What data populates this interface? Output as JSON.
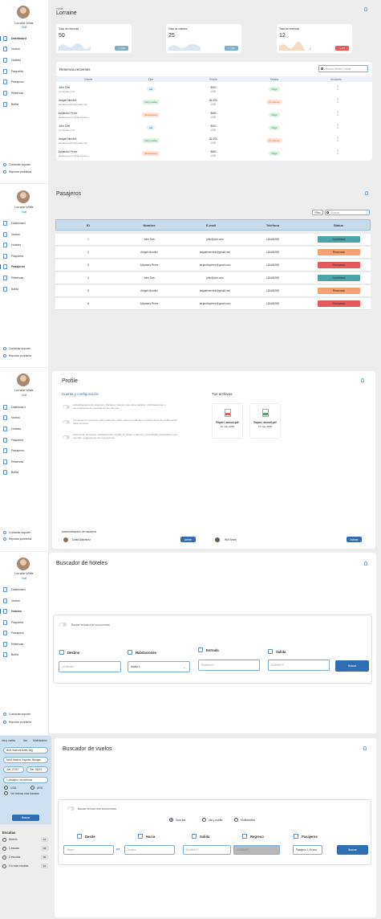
{
  "user": {
    "name": "Lorraine White",
    "role": "Staff"
  },
  "nav": [
    "Dashboard",
    "Vuelos",
    "Hoteles",
    "Paquetes",
    "Pasajeros",
    "Reservas",
    "Bolita"
  ],
  "footer": {
    "support": "Contactar soporte",
    "report": "Reportar problema"
  },
  "dashboard": {
    "greeting": "Hola,",
    "name": "Lorraine",
    "stats": [
      {
        "title": "Total de reservas",
        "value": "50",
        "badge": "14%",
        "color": "#7fb0c9"
      },
      {
        "title": "Total de clientes",
        "value": "25",
        "badge": "19%",
        "color": "#7fb0c9"
      },
      {
        "title": "Total de reservas",
        "value": "12",
        "badge": "2%",
        "color": "#e85a5a"
      }
    ],
    "recent_title": "Reservas recientes",
    "search_placeholder": "Buscar cliente o email",
    "columns": [
      "Cliente",
      "Tipo",
      "Precio",
      "Estado",
      "Acciones"
    ],
    "rows": [
      {
        "name": "John Doe",
        "email": "john@doe.com",
        "type": "Ida",
        "price": "$990",
        "cur": "USD",
        "status": "Pago"
      },
      {
        "name": "Abigail Mendez",
        "email": "abigailmendez@gmail.com",
        "type": "Ida y vuelta",
        "price": "$1.000",
        "cur": "USD",
        "status": "Pendiente"
      },
      {
        "name": "Alejandro Perez",
        "email": "alejandroperez@gmail.com",
        "type": "Multidestino",
        "price": "$690",
        "cur": "USD",
        "status": "Pago"
      },
      {
        "name": "John Doe",
        "email": "john@doe.com",
        "type": "Ida",
        "price": "$990",
        "cur": "USD",
        "status": "Pago"
      },
      {
        "name": "Abigail Mendez",
        "email": "abigailmendez@gmail.com",
        "type": "Ida y vuelta",
        "price": "$1.000",
        "cur": "USD",
        "status": "Pendiente"
      },
      {
        "name": "Alejandro Perez",
        "email": "alejandroperez@gmail.com",
        "type": "Multidestino",
        "price": "$890",
        "cur": "USD",
        "status": "Pago"
      }
    ]
  },
  "pasajeros": {
    "title": "Pasajeros",
    "filter": "Filtro",
    "search_placeholder": "Buscar",
    "columns": [
      "ID",
      "Nombre",
      "E-mail",
      "Teléfono",
      "Status"
    ],
    "rows": [
      {
        "id": "1",
        "name": "John Doe",
        "email": "john@doe.com",
        "phone": "123456789",
        "status": "Confirmado"
      },
      {
        "id": "2",
        "name": "Abigail Mendez",
        "email": "abigailmendez@gmail.com",
        "phone": "123456789",
        "status": "Reservado"
      },
      {
        "id": "3",
        "name": "Alejandro Perez",
        "email": "alejandroperez@gmail.com",
        "phone": "123456789",
        "status": "Rechazado"
      },
      {
        "id": "4",
        "name": "John Doe",
        "email": "john@doe.com",
        "phone": "123456789",
        "status": "Confirmado"
      },
      {
        "id": "5",
        "name": "Abigail Mendez",
        "email": "abigailmendez@gmail.com",
        "phone": "123456789",
        "status": "Reservado"
      },
      {
        "id": "6",
        "name": "Alejandro Perez",
        "email": "alejandroperez@gmail.com",
        "phone": "123456789",
        "status": "Rechazado"
      }
    ]
  },
  "profile": {
    "title": "Profile",
    "config_title": "Cuenta y configuración",
    "files_title": "Tus archivos",
    "settings": [
      "Actualizaciones de reservas: Alertas en tiempo real sobre pedidos, confirmaciones o cancelaciones de reservas de los clientes.",
      "Vencimientos próximos: Recordatorios sobre pagos pendientes o fechas límite de confirmación para servicios.",
      "Asignación de tareas: Notificaciones cuando se asignen clientes o actividades específicas (por ejemplo, seguimiento de una reserva)."
    ],
    "files": [
      {
        "name": "Report_annual.pdf",
        "date": "27 may 2020"
      },
      {
        "name": "Report_annual.pdf",
        "date": "27 may 2020"
      }
    ],
    "admin_title": "Administración de usuarios",
    "admin_users": [
      {
        "name": "Tubila Altamirez",
        "action": "Admin"
      },
      {
        "name": "Will Smith",
        "action": "Activar"
      }
    ]
  },
  "hoteles": {
    "title": "Buscador de hoteles",
    "toggle": "Buscar fechas más económicas",
    "fields": {
      "destino": "Destino",
      "habitaciones": "Habitaciones",
      "entrada": "Entrada",
      "salida": "Salida"
    },
    "destino_ph": "¿A dónde?",
    "habitaciones_val": "Adulto 1",
    "fecha_ph": "DD/MM/YY",
    "search": "Buscar"
  },
  "side5": {
    "trip_types": [
      "Ida y vuelta",
      "Ida",
      "Multidestino"
    ],
    "inputs": [
      "BUE Buenos Aires, Arg",
      "MAD Madrid, España, Barajas",
      "Jue, 27/02",
      "Jue, 06/03",
      "1 pasajero, económica"
    ],
    "currency": [
      "USD",
      "ARS"
    ],
    "flex": "Ver fechas más baratas",
    "search": "Buscar",
    "stops_title": "Escalas",
    "stops": [
      {
        "label": "Directo",
        "count": "12"
      },
      {
        "label": "1 escala",
        "count": "34"
      },
      {
        "label": "2 escalas",
        "count": "56"
      },
      {
        "label": "3 o más escalas",
        "count": "10"
      }
    ]
  },
  "vuelos": {
    "title": "Buscador de vuelos",
    "toggle": "Buscar fechas más económicas",
    "trip_types": [
      "Solo ida",
      "Ida y vuelta",
      "Multidestino"
    ],
    "fields": {
      "desde": "Desde",
      "hacia": "Hacia",
      "salida": "Salida",
      "regreso": "Regreso",
      "pasajeros": "Pasajeros"
    },
    "origen_ph": "Origen",
    "destino_ph": "Destino",
    "fecha_ph": "DD/MM/YY",
    "pasajeros_val": "Pasajero 1, Econó",
    "search": "Buscar"
  },
  "colors": {
    "primary": "#2f6eb0",
    "confirmado": "#4fa3a5",
    "reservado": "#f3a372",
    "rechazado": "#e85a5a",
    "header": "#c9dcee"
  }
}
